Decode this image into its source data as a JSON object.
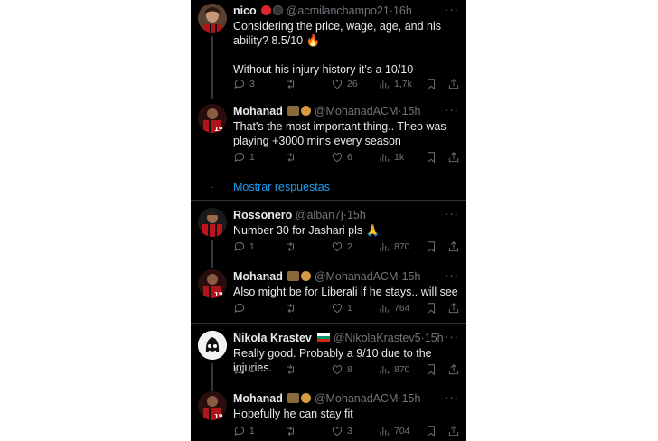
{
  "colors": {
    "background": "#000000",
    "text": "#e7e9ea",
    "muted": "#71767b",
    "link": "#1d9bf0",
    "divider": "#2f3336"
  },
  "tweets": [
    {
      "name": "nico",
      "handle": "@acmilanchampo21",
      "time": "16h",
      "text": "Considering the price, wage, age, and his ability? 8.5/10 🔥\n\nWithout his injury history it’s a 10/10",
      "replies": "3",
      "retweets": "",
      "likes": "26",
      "views": "1,7k"
    },
    {
      "name": "Mohanad",
      "handle": "@MohanadACM",
      "time": "15h",
      "text": "That's the most important thing.. Theo was playing +3000 mins every season",
      "replies": "1",
      "retweets": "",
      "likes": "6",
      "views": "1k"
    },
    {
      "name": "Rossonero",
      "handle": "@alban7j",
      "time": "15h",
      "text": "Number 30 for Jashari pls 🙏",
      "replies": "1",
      "retweets": "",
      "likes": "2",
      "views": "870"
    },
    {
      "name": "Mohanad",
      "handle": "@MohanadACM",
      "time": "15h",
      "text": "Also might be for Liberali if he stays.. will see",
      "replies": "",
      "retweets": "",
      "likes": "1",
      "views": "764"
    },
    {
      "name": "Nikola Krastev",
      "handle": "@NikolaKrastev5",
      "time": "15h",
      "text": "Really good. Probably a 9/10 due to the injuries.",
      "replies": "1",
      "retweets": "",
      "likes": "8",
      "views": "870"
    },
    {
      "name": "Mohanad",
      "handle": "@MohanadACM",
      "time": "15h",
      "text": "Hopefully he can stay fit",
      "replies": "1",
      "retweets": "",
      "likes": "3",
      "views": "704"
    }
  ],
  "show_replies_label": "Mostrar respuestas",
  "separator": "·",
  "more_label": "···"
}
